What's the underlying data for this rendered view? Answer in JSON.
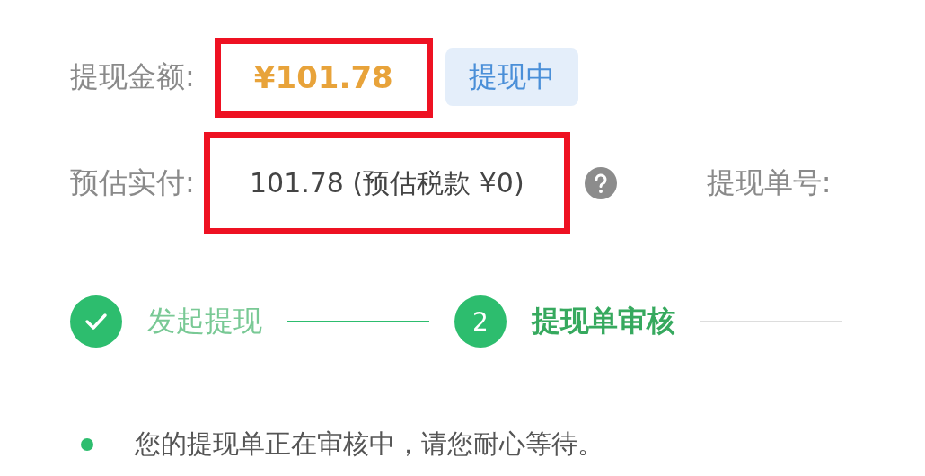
{
  "amount_row": {
    "label": "提现金额:",
    "value": "¥101.78",
    "highlighted": true,
    "status_badge": "提现中"
  },
  "actual_row": {
    "label": "预估实付:",
    "value": "101.78 (预估税款 ¥0)",
    "highlighted": true,
    "order_label": "提现单号:"
  },
  "steps": [
    {
      "kind": "done",
      "label": "发起提现"
    },
    {
      "kind": "active",
      "number": "2",
      "label": "提现单审核"
    }
  ],
  "note": "您的提现单正在审核中，请您耐心等待。"
}
